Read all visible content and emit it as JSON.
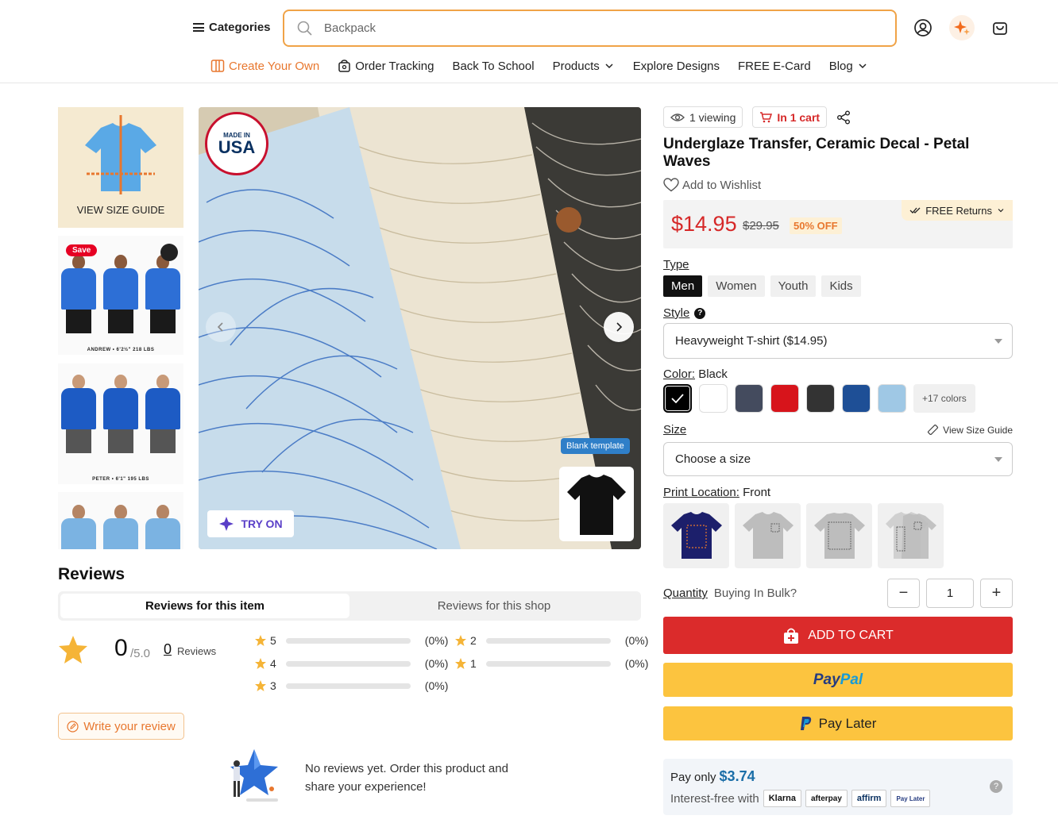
{
  "header": {
    "categories_label": "Categories",
    "search_placeholder": "Backpack"
  },
  "nav": {
    "items": [
      {
        "label": "Create Your Own"
      },
      {
        "label": "Order Tracking"
      },
      {
        "label": "Back To School"
      },
      {
        "label": "Products"
      },
      {
        "label": "Explore Designs"
      },
      {
        "label": "FREE E-Card"
      },
      {
        "label": "Blog"
      }
    ]
  },
  "gallery": {
    "size_guide_label": "VIEW SIZE GUIDE",
    "save_label": "Save",
    "thumb1_caption": "ANDREW • 6'2½\" 218 LBS",
    "thumb2_caption": "PETER • 6'1\" 195 LBS",
    "badge_made_in": "MADE IN",
    "badge_country": "USA",
    "try_on_label": "TRY ON",
    "blank_template_label": "Blank template"
  },
  "product": {
    "viewing": "1 viewing",
    "in_cart": "In 1 cart",
    "title": "Underglaze Transfer, Ceramic Decal - Petal Waves",
    "wishlist_label": "Add to Wishlist",
    "free_returns": "FREE Returns",
    "price": "$14.95",
    "old_price": "$29.95",
    "discount": "50% OFF",
    "type_label": "Type",
    "types": [
      "Men",
      "Women",
      "Youth",
      "Kids"
    ],
    "selected_type": "Men",
    "style_label": "Style",
    "style_value": "Heavyweight T-shirt ($14.95)",
    "color_label": "Color:",
    "color_value": "Black",
    "swatches": [
      "#000000",
      "#ffffff",
      "#444b5e",
      "#d7141b",
      "#333333",
      "#1e4f96",
      "#9fc8e5"
    ],
    "more_colors": "+17 colors",
    "size_label": "Size",
    "size_guide_link": "View Size Guide",
    "size_placeholder": "Choose a size",
    "print_location_label": "Print Location:",
    "print_location_value": "Front",
    "quantity_label": "Quantity",
    "bulk_label": "Buying In Bulk?",
    "quantity": "1",
    "add_to_cart": "ADD TO CART",
    "paypal_label": "PayPal",
    "pay_later_label": "Pay Later",
    "pay_only_label": "Pay only",
    "pay_only_amount": "$3.74",
    "interest_free": "Interest-free with",
    "bnpl": [
      "Klarna",
      "afterpay",
      "affirm",
      "Pay Later"
    ]
  },
  "reviews": {
    "title": "Reviews",
    "tab_item": "Reviews for this item",
    "tab_shop": "Reviews for this shop",
    "score": "0",
    "out_of": "/5.0",
    "count": "0",
    "count_label": "Reviews",
    "breakdown": [
      {
        "stars": "5",
        "pct": "(0%)",
        "fraction": 0
      },
      {
        "stars": "4",
        "pct": "(0%)",
        "fraction": 0
      },
      {
        "stars": "3",
        "pct": "(0%)",
        "fraction": 0
      },
      {
        "stars": "2",
        "pct": "(0%)",
        "fraction": 0
      },
      {
        "stars": "1",
        "pct": "(0%)",
        "fraction": 0
      }
    ],
    "write_review": "Write your review",
    "empty_message": "No reviews yet. Order this product and share your experience!"
  }
}
